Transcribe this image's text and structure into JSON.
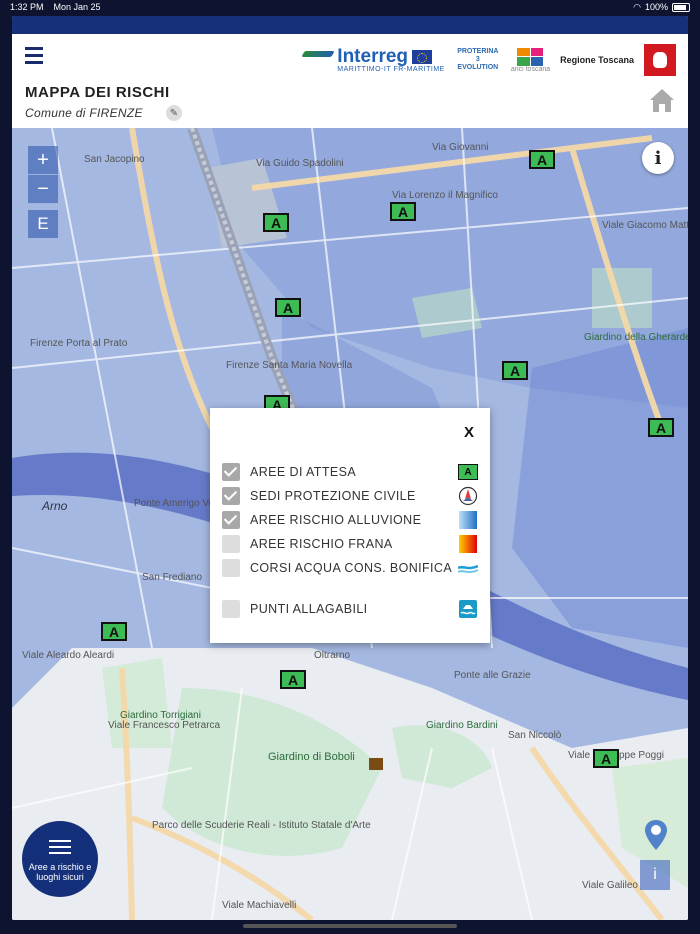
{
  "status": {
    "time": "1:32 PM",
    "date": "Mon Jan 25",
    "battery": "100%"
  },
  "header": {
    "title": "MAPPA DEI RISCHI",
    "subtitle": "Comune di FIRENZE",
    "logos": {
      "interreg": "Interreg",
      "interreg_sub": "MARITTIMO-IT FR-MARITIME",
      "proterina": "PROTERINA 3 EVOLUTION",
      "anci": "anci toscana",
      "regione": "Regione Toscana"
    }
  },
  "map": {
    "zoom_in": "+",
    "zoom_out": "−",
    "extent": "E",
    "info": "i",
    "marker_label": "A",
    "labels": {
      "arno": "Arno",
      "porta_prato": "Firenze Porta al Prato",
      "smn": "Firenze Santa Maria Novella",
      "ponte_vespucci": "Ponte Amerigo Vespucci",
      "boboli": "Giardino di Boboli",
      "ponte_grazie": "Ponte alle Grazie",
      "oltrarno": "Oltrarno",
      "san_frediano": "San Frediano",
      "san_niccolo": "San Niccolò",
      "torrigiani": "Giardino Torrigiani",
      "ghirardesca": "Giardino della Gherardesca",
      "bardini": "Giardino Bardini",
      "lorenzo": "Via Lorenzo il Magnifico",
      "giovanni": "Via Giovanni",
      "spadolini": "Via Guido Spadolini",
      "jacopino": "San Jacopino",
      "matteotti": "Viale Giacomo Matteotti",
      "petrarca": "Viale Francesco Petrarca",
      "machiavelli": "Viale Machiavelli",
      "galileo": "Viale Galileo",
      "scuderie": "Parco delle Scuderie Reali - Istituto Statale d'Arte",
      "poggi": "Viale Giuseppe Poggi",
      "aleardi": "Viale Aleardo Aleardi"
    }
  },
  "legend": {
    "close": "X",
    "items": [
      {
        "label": "AREE DI ATTESA",
        "checked": true,
        "icon": "area-attesa-icon"
      },
      {
        "label": "SEDI PROTEZIONE CIVILE",
        "checked": true,
        "icon": "protezione-civile-icon"
      },
      {
        "label": "AREE RISCHIO ALLUVIONE",
        "checked": true,
        "icon": "alluvione-gradient-icon"
      },
      {
        "label": "AREE RISCHIO FRANA",
        "checked": false,
        "icon": "frana-gradient-icon"
      },
      {
        "label": "CORSI ACQUA CONS. BONIFICA",
        "checked": false,
        "icon": "corsi-acqua-icon"
      },
      {
        "label": "PUNTI ALLAGABILI",
        "checked": false,
        "icon": "punti-allagabili-icon"
      }
    ]
  },
  "fab": {
    "label": "Aree a rischio e luoghi sicuri"
  },
  "bottom": {
    "info": "i"
  },
  "colors": {
    "navy": "#15307a",
    "marker_green": "#3dbb54",
    "flood_blue": "#5a72c8"
  }
}
